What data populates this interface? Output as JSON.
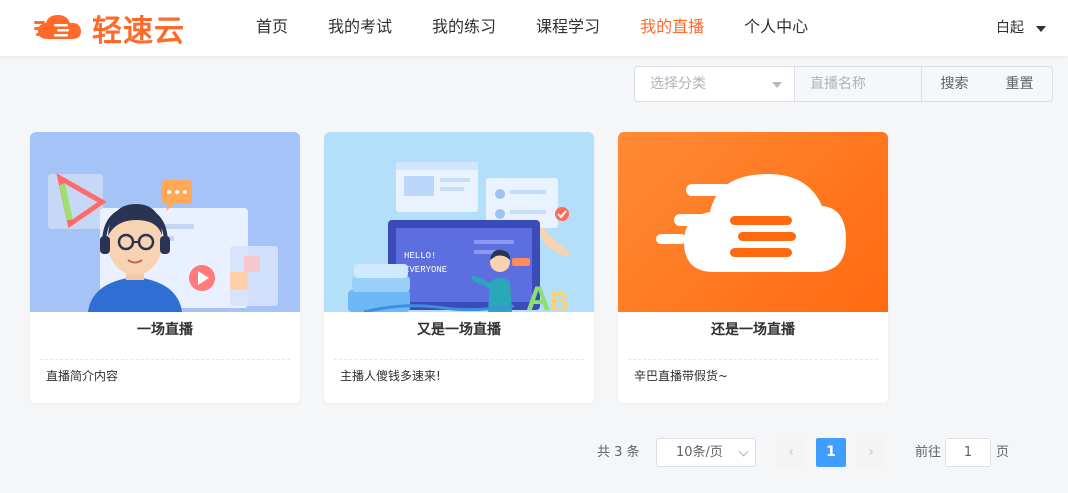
{
  "brand": {
    "name": "轻速云",
    "accent": "#ff6a2b"
  },
  "nav": [
    {
      "label": "首页",
      "active": false
    },
    {
      "label": "我的考试",
      "active": false
    },
    {
      "label": "我的练习",
      "active": false
    },
    {
      "label": "课程学习",
      "active": false
    },
    {
      "label": "我的直播",
      "active": true
    },
    {
      "label": "个人中心",
      "active": false
    }
  ],
  "user": {
    "name": "白起"
  },
  "filter": {
    "category_placeholder": "选择分类",
    "name_placeholder": "直播名称",
    "search_label": "搜索",
    "reset_label": "重置"
  },
  "cards": [
    {
      "title": "一场直播",
      "desc": "直播简介内容",
      "cover_icon": "tutor-headset-illustration"
    },
    {
      "title": "又是一场直播",
      "desc": "主播人傻钱多速来!",
      "cover_icon": "presenter-screen-illustration",
      "screen_text": [
        "HELLO!",
        "EVERYONE"
      ]
    },
    {
      "title": "还是一场直播",
      "desc": "辛巴直播带假货~",
      "cover_icon": "cloud-logo-icon"
    }
  ],
  "pagination": {
    "total_text": "共 3 条",
    "page_size": "10条/页",
    "current_page": "1",
    "jump_label": "前往",
    "jump_value": "1",
    "jump_suffix": "页"
  },
  "colors": {
    "card1_bg": "#a6c3f7",
    "card2_bg": "#b4dffb",
    "card3_bg": "#ff7a1f",
    "pager_active": "#409eff"
  }
}
